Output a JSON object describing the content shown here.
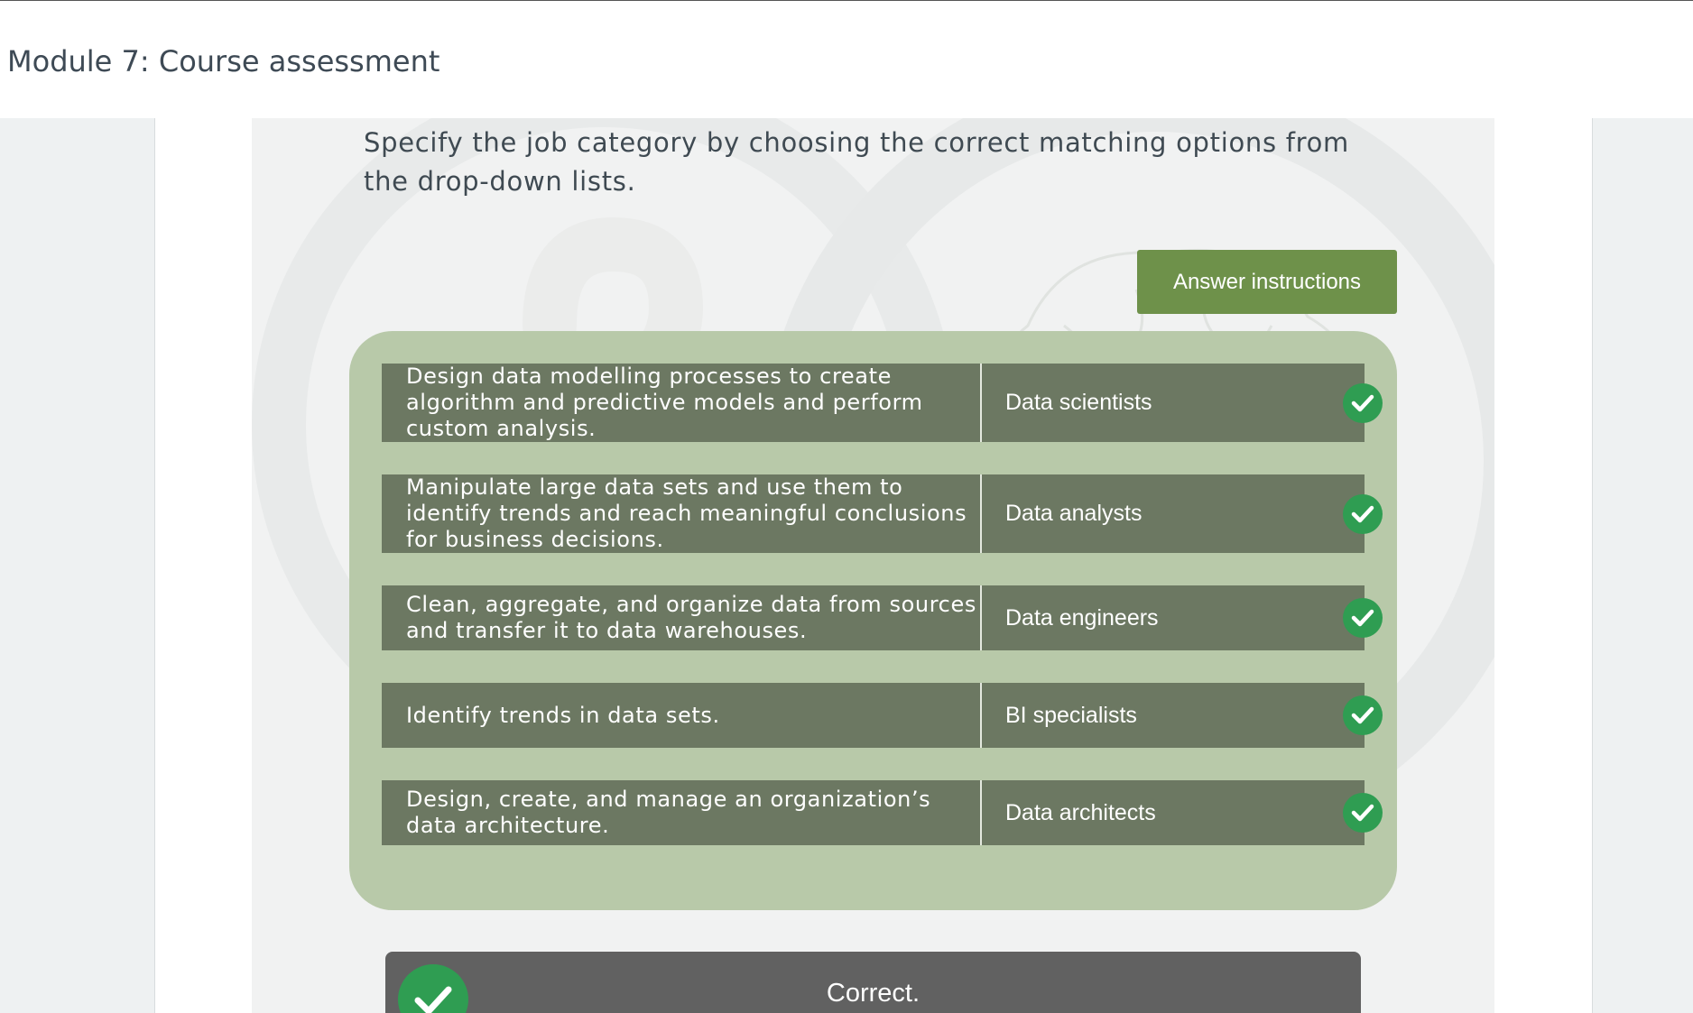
{
  "header": {
    "title": "Module 7: Course assessment"
  },
  "question": {
    "prompt": "Specify the job category by choosing the correct matching options from the drop-down lists.",
    "instructions_button": "Answer instructions"
  },
  "rows": [
    {
      "description": "Design data modelling processes to create algorithm and predictive models and perform custom analysis.",
      "answer": "Data scientists",
      "status": "correct"
    },
    {
      "description": "Manipulate large data sets and use them to identify trends and reach meaningful conclusions for business decisions.",
      "answer": "Data analysts",
      "status": "correct"
    },
    {
      "description": "Clean, aggregate, and organize data from sources and transfer it to data warehouses.",
      "answer": "Data engineers",
      "status": "correct"
    },
    {
      "description": "Identify trends in data sets.",
      "answer": "BI specialists",
      "status": "correct"
    },
    {
      "description": "Design, create, and manage an organization’s data architecture.",
      "answer": "Data architects",
      "status": "correct"
    }
  ],
  "feedback": {
    "message": "Correct."
  },
  "colors": {
    "accent_green": "#6e914a",
    "panel_green": "#b8c9a9",
    "row_bg": "#6c7862",
    "check_green": "#2f9d52",
    "feedback_bg": "#616161"
  }
}
